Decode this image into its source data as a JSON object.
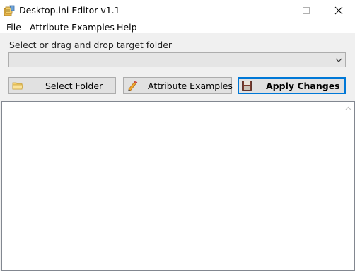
{
  "window": {
    "title": "Desktop.ini Editor v1.1",
    "icons": {
      "app": "desktop-ini-app-icon",
      "minimize": "minimize-icon",
      "maximize": "maximize-icon",
      "close": "close-icon"
    }
  },
  "menu": {
    "items": [
      {
        "label": "File"
      },
      {
        "label": "Attribute Examples"
      },
      {
        "label": "Help"
      }
    ]
  },
  "target": {
    "prompt": "Select or drag and drop target folder",
    "selected_value": ""
  },
  "buttons": {
    "select_folder": {
      "label": "Select Folder",
      "icon": "folder-icon"
    },
    "attribute_examples": {
      "label": "Attribute Examples",
      "icon": "pencil-icon"
    },
    "apply_changes": {
      "label": "Apply Changes",
      "icon": "save-icon"
    }
  },
  "editor": {
    "content": ""
  },
  "colors": {
    "focus_border": "#0078d7",
    "window_bg": "#f0f0f0",
    "button_bg": "#e1e1e1"
  }
}
